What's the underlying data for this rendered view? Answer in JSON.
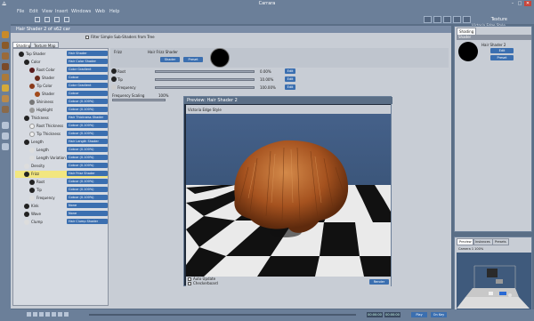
{
  "window": {
    "title": "Carrara"
  },
  "menu": [
    "File",
    "Edit",
    "View",
    "Insert",
    "Windows",
    "Web",
    "Help"
  ],
  "toolbar": {
    "texture_label": "Texture",
    "right_subtitle": "Victoria Edge Style"
  },
  "shader_panel": {
    "title": "Hair Shader 2 of s62 car",
    "filter_label": "Filter Simple Sub-Shaders from Tree",
    "tabs": [
      "Shading",
      "Texture Map"
    ],
    "tree": [
      {
        "label": "Top Shader",
        "value": "Hair Shader"
      },
      {
        "label": "Color",
        "value": "Hair Color Shader"
      },
      {
        "label": "Root Color",
        "value": "Color Gradient"
      },
      {
        "label": "Shader",
        "value": "Colour"
      },
      {
        "label": "Tip Color",
        "value": "Color Gradient"
      },
      {
        "label": "Shader",
        "value": "Colour"
      },
      {
        "label": "Shininess",
        "value": "Colour (0.100%)"
      },
      {
        "label": "Highlight",
        "value": "Colour (0.100%)"
      },
      {
        "label": "Thickness",
        "value": "Hair Thickness Shader"
      },
      {
        "label": "Root Thickness",
        "value": "Colour (0.100%)"
      },
      {
        "label": "Tip Thickness",
        "value": "Colour (0.100%)"
      },
      {
        "label": "Length",
        "value": "Hair Length Shader"
      },
      {
        "label": "Length",
        "value": "Colour (0.100%)"
      },
      {
        "label": "Length Variation",
        "value": "Colour (0.100%)"
      },
      {
        "label": "Density",
        "value": "Colour (0.100%)"
      },
      {
        "label": "Frizz",
        "value": "Hair Frizz Shader"
      },
      {
        "label": "Root",
        "value": "Colour (0.100%)"
      },
      {
        "label": "Tip",
        "value": "Colour (0.100%)"
      },
      {
        "label": "Frequency",
        "value": "Colour (0.100%)"
      },
      {
        "label": "Kink",
        "value": "None"
      },
      {
        "label": "Wave",
        "value": "None"
      },
      {
        "label": "Clump",
        "value": "Hair Clump Shader"
      }
    ],
    "header_label": "Frizz",
    "header_value": "Hair Frizz Shader",
    "header_buttons": [
      "Shader",
      "Preset"
    ],
    "params": [
      {
        "label": "Root",
        "value": "0.00%",
        "edit": "Edit"
      },
      {
        "label": "Tip",
        "value": "10.00%",
        "edit": "Edit"
      },
      {
        "label": "Frequency",
        "value": "100.00%",
        "edit": "Edit"
      }
    ],
    "freq_scaling": {
      "label": "Frequency Scaling",
      "value": "100%"
    }
  },
  "preview": {
    "title": "Preview: Hair Shader 2",
    "subtitle": "Victoria Edge Style",
    "auto_update_label": "Auto Update",
    "checkerboard_label": "Checkerboard",
    "render_label": "Render"
  },
  "right_panel": {
    "tab": "Shading",
    "subtab": "Shader",
    "shader_name": "Hair Shader 2",
    "buttons": [
      "Edit",
      "Preset"
    ]
  },
  "nav_panel": {
    "tabs": [
      "Preview",
      "Instances",
      "Presets"
    ],
    "camera_label": "Camera 1  100%"
  },
  "bottom": {
    "timecode": "00:00:00",
    "right_labels": [
      "Play",
      "On Key"
    ]
  },
  "colors": {
    "chrome": "#6b7f99",
    "panel": "#c8cdd5",
    "dropdown": "#3b6fb0",
    "selection": "#f2e680",
    "hair": "#a5521f"
  }
}
